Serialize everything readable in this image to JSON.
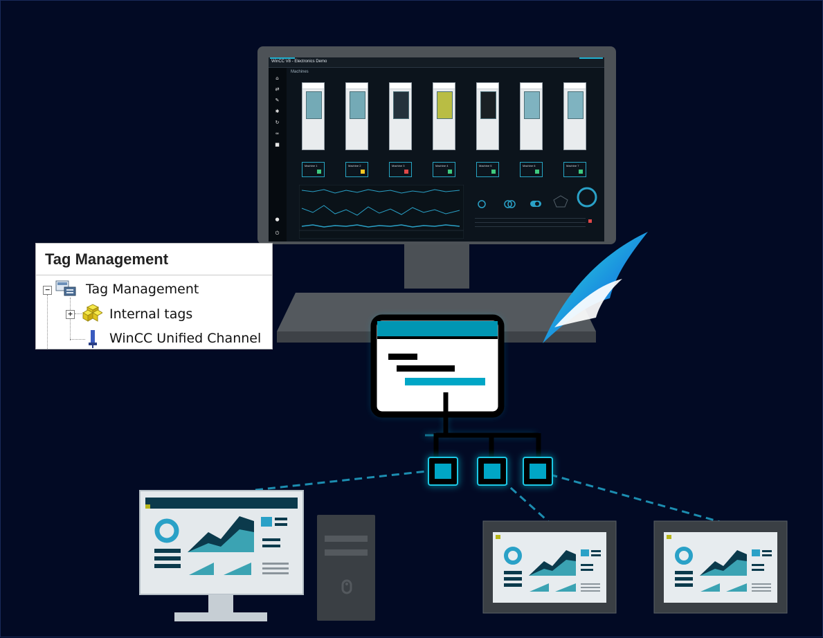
{
  "tag_management": {
    "title": "Tag Management",
    "tree": [
      {
        "label": "Tag Management",
        "expander": "−"
      },
      {
        "label": "Internal tags",
        "expander": "+"
      },
      {
        "label": "WinCC Unified Channel"
      }
    ]
  },
  "hmi_screen": {
    "window_title": "WinCC V8 - Electronics Demo",
    "section_label": "Machines",
    "machines": [
      {
        "label": "Machine 1",
        "status": "#3fc97e",
        "window": "#74aab6"
      },
      {
        "label": "Machine 2",
        "status": "#f3c623",
        "window": "#74aab6"
      },
      {
        "label": "Machine 3",
        "status": "#e04848",
        "window": "#24323c"
      },
      {
        "label": "Machine 4",
        "status": "#3fc97e",
        "window": "#b9bd44"
      },
      {
        "label": "Machine 5",
        "status": "#3fc97e",
        "window": "#1a2024"
      },
      {
        "label": "Machine 6",
        "status": "#3fc97e",
        "window": "#7fb3c0"
      },
      {
        "label": "Machine 7",
        "status": "#3fc97e",
        "window": "#7fb3c0"
      }
    ],
    "sidebar_icons": [
      "home-icon",
      "transfer-icon",
      "wrench-icon",
      "gear-icon",
      "sync-icon",
      "glasses-icon",
      "camera-icon",
      "info-icon",
      "power-icon"
    ]
  },
  "colors": {
    "background": "#020a24",
    "accent_cyan": "#00a6c6",
    "glow": "#1ec8e6",
    "device_gray": "#3a3f44",
    "panel_light": "#e7ecef"
  },
  "icons": {
    "server_hierarchy": "hierarchy-server-icon",
    "shark_fin": "shark-fin-icon",
    "desktop_pc": "desktop-pc-icon",
    "tower": "pc-tower-icon",
    "panel_left": "hmi-panel-icon",
    "panel_right": "hmi-panel-icon"
  }
}
